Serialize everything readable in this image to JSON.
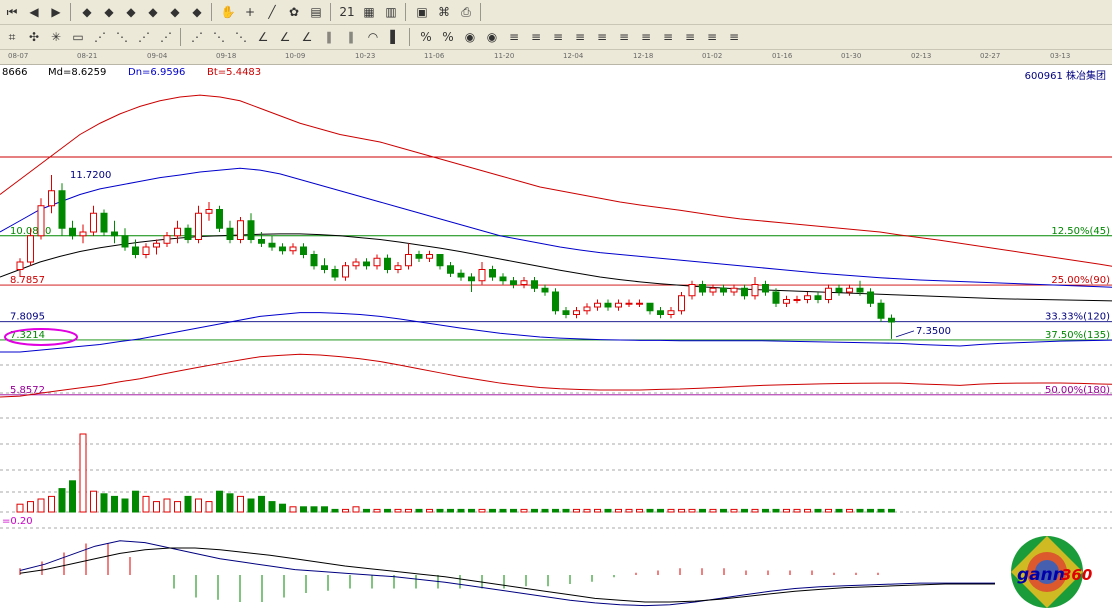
{
  "toolbar1": {
    "buttons": [
      {
        "icon": "first-icon",
        "glyph": "⏮"
      },
      {
        "icon": "back-icon",
        "glyph": "◀"
      },
      {
        "icon": "forward-icon",
        "glyph": "▶"
      },
      {
        "icon": "gann-diamond-1-icon",
        "glyph": "◆"
      },
      {
        "icon": "gann-diamond-2-icon",
        "glyph": "◆"
      },
      {
        "icon": "gann-diamond-3-icon",
        "glyph": "◆"
      },
      {
        "icon": "gann-diamond-4-icon",
        "glyph": "◆"
      },
      {
        "icon": "gann-diamond-5-icon",
        "glyph": "◆"
      },
      {
        "icon": "gann-diamond-6-icon",
        "glyph": "◆"
      },
      {
        "icon": "hand-icon",
        "glyph": "✋"
      },
      {
        "icon": "crosshair-icon",
        "glyph": "+"
      },
      {
        "icon": "line-tool-icon",
        "glyph": "╱"
      },
      {
        "icon": "pattern-icon",
        "glyph": "✿"
      },
      {
        "icon": "stats-icon",
        "glyph": "▤"
      },
      {
        "icon": "calendar-icon",
        "glyph": "21"
      },
      {
        "icon": "calculator-icon",
        "glyph": "▦"
      },
      {
        "icon": "table-icon",
        "glyph": "▥"
      },
      {
        "icon": "save-icon",
        "glyph": "▣"
      },
      {
        "icon": "network-icon",
        "glyph": "⌘"
      },
      {
        "icon": "print-icon",
        "glyph": "⎙"
      }
    ]
  },
  "toolbar2": {
    "buttons": [
      {
        "icon": "gann-grid-icon",
        "glyph": "⌗"
      },
      {
        "icon": "gann-square-icon",
        "glyph": "✣"
      },
      {
        "icon": "gann-wheel-icon",
        "glyph": "✳"
      },
      {
        "icon": "box-icon",
        "glyph": "▭"
      },
      {
        "icon": "gann-fan-1-icon",
        "glyph": "⋰"
      },
      {
        "icon": "gann-fan-2-icon",
        "glyph": "⋱"
      },
      {
        "icon": "gann-fan-3-icon",
        "glyph": "⋰"
      },
      {
        "icon": "gann-fan-4-icon",
        "glyph": "⋰"
      },
      {
        "icon": "gann-fan-5-icon",
        "glyph": "⋰"
      },
      {
        "icon": "gann-fan-6-icon",
        "glyph": "⋱"
      },
      {
        "icon": "gann-fan-7-icon",
        "glyph": "⋱"
      },
      {
        "icon": "angle-1-icon",
        "glyph": "∠"
      },
      {
        "icon": "angle-2-icon",
        "glyph": "∠"
      },
      {
        "icon": "angle-3-icon",
        "glyph": "∠"
      },
      {
        "icon": "time-cycle-icon",
        "glyph": "∥"
      },
      {
        "icon": "time-cycle-2-icon",
        "glyph": "∥"
      },
      {
        "icon": "arc-icon",
        "glyph": "◠"
      },
      {
        "icon": "column-icon",
        "glyph": "▌"
      },
      {
        "icon": "percent-1-icon",
        "glyph": "%"
      },
      {
        "icon": "percent-2-icon",
        "glyph": "%"
      },
      {
        "icon": "gold-1-icon",
        "glyph": "◉"
      },
      {
        "icon": "gold-2-icon",
        "glyph": "◉"
      },
      {
        "icon": "fib-1-icon",
        "glyph": "≡"
      },
      {
        "icon": "fib-2-icon",
        "glyph": "≡"
      },
      {
        "icon": "fib-3-icon",
        "glyph": "≡"
      },
      {
        "icon": "fib-4-icon",
        "glyph": "≡"
      },
      {
        "icon": "fib-5-icon",
        "glyph": "≡"
      },
      {
        "icon": "fib-6-icon",
        "glyph": "≡"
      },
      {
        "icon": "fib-7-icon",
        "glyph": "≡"
      },
      {
        "icon": "fib-8-icon",
        "glyph": "≡"
      },
      {
        "icon": "fib-9-icon",
        "glyph": "≡"
      },
      {
        "icon": "fib-10-icon",
        "glyph": "≡"
      },
      {
        "icon": "fib-11-icon",
        "glyph": "≡"
      }
    ]
  },
  "date_axis": {
    "ticks": [
      "08-07",
      "08-21",
      "09-04",
      "09-18",
      "10-09",
      "10-23",
      "11-06",
      "11-20",
      "12-04",
      "12-18",
      "01-02",
      "01-16",
      "01-30",
      "02-13",
      "02-27",
      "03-13"
    ]
  },
  "info_bar": {
    "partial_value": "8666",
    "md": "Md=8.6259",
    "dn": "Dn=6.9596",
    "bt": "Bt=5.4483",
    "stock": "600961  株冶集团"
  },
  "colors": {
    "up": "#e00000",
    "down": "#008800",
    "upper_band": "#cc0000",
    "ma_blue": "#0000cc",
    "ma_black": "#000000",
    "fib_purple": "#990099",
    "ellipse": "#e000e0",
    "grid_dash": "#555555"
  },
  "chart_data": {
    "type": "candlestick",
    "title": "",
    "xlabel": "",
    "ylabel": "",
    "x": [
      "08-07",
      "08-21",
      "09-04",
      "09-18",
      "10-09",
      "10-23",
      "11-06",
      "11-20",
      "12-04",
      "12-18",
      "01-02",
      "01-16",
      "01-30",
      "02-13",
      "02-27",
      "03-13"
    ],
    "price_annotations": {
      "high_label": "11.7200",
      "low_label": "7.3500"
    },
    "horizontal_levels": [
      {
        "value": 12.2,
        "color": "#cc0000",
        "left_label": "",
        "right_label": ""
      },
      {
        "value": 10.1,
        "color": "#008800",
        "left_label": "10.0800",
        "right_label": "12.50%(45)"
      },
      {
        "value": 8.7857,
        "color": "#cc0000",
        "left_label": "8.7857",
        "right_label": "25.00%(90)"
      },
      {
        "value": 7.8095,
        "color": "#000080",
        "left_label": "7.8095",
        "right_label": "33.33%(120)"
      },
      {
        "value": 7.3214,
        "color": "#008800",
        "left_label": "7.3214",
        "right_label": "37.50%(135)"
      },
      {
        "value": 5.8572,
        "color": "#990099",
        "left_label": "5.8572",
        "right_label": "50.00%(180)"
      }
    ],
    "candles": [
      {
        "o": 9.2,
        "h": 9.5,
        "l": 9.0,
        "c": 9.4
      },
      {
        "o": 9.4,
        "h": 10.3,
        "l": 9.3,
        "c": 10.1
      },
      {
        "o": 10.1,
        "h": 11.1,
        "l": 10.0,
        "c": 10.9
      },
      {
        "o": 10.9,
        "h": 11.72,
        "l": 10.7,
        "c": 11.3
      },
      {
        "o": 11.3,
        "h": 11.5,
        "l": 10.1,
        "c": 10.3
      },
      {
        "o": 10.3,
        "h": 10.5,
        "l": 10.0,
        "c": 10.1
      },
      {
        "o": 10.1,
        "h": 10.4,
        "l": 9.9,
        "c": 10.2
      },
      {
        "o": 10.2,
        "h": 10.9,
        "l": 10.1,
        "c": 10.7
      },
      {
        "o": 10.7,
        "h": 10.8,
        "l": 10.1,
        "c": 10.2
      },
      {
        "o": 10.2,
        "h": 10.5,
        "l": 9.9,
        "c": 10.1
      },
      {
        "o": 10.1,
        "h": 10.3,
        "l": 9.7,
        "c": 9.8
      },
      {
        "o": 9.8,
        "h": 10.0,
        "l": 9.5,
        "c": 9.6
      },
      {
        "o": 9.6,
        "h": 9.9,
        "l": 9.5,
        "c": 9.8
      },
      {
        "o": 9.8,
        "h": 10.0,
        "l": 9.6,
        "c": 9.9
      },
      {
        "o": 9.9,
        "h": 10.2,
        "l": 9.8,
        "c": 10.1
      },
      {
        "o": 10.1,
        "h": 10.5,
        "l": 9.9,
        "c": 10.3
      },
      {
        "o": 10.3,
        "h": 10.4,
        "l": 9.9,
        "c": 10.0
      },
      {
        "o": 10.0,
        "h": 10.9,
        "l": 9.9,
        "c": 10.7
      },
      {
        "o": 10.7,
        "h": 11.0,
        "l": 10.5,
        "c": 10.8
      },
      {
        "o": 10.8,
        "h": 10.9,
        "l": 10.2,
        "c": 10.3
      },
      {
        "o": 10.3,
        "h": 10.5,
        "l": 9.9,
        "c": 10.0
      },
      {
        "o": 10.0,
        "h": 10.6,
        "l": 9.9,
        "c": 10.5
      },
      {
        "o": 10.5,
        "h": 10.7,
        "l": 9.9,
        "c": 10.0
      },
      {
        "o": 10.0,
        "h": 10.2,
        "l": 9.8,
        "c": 9.9
      },
      {
        "o": 9.9,
        "h": 10.1,
        "l": 9.7,
        "c": 9.8
      },
      {
        "o": 9.8,
        "h": 9.9,
        "l": 9.6,
        "c": 9.7
      },
      {
        "o": 9.7,
        "h": 9.9,
        "l": 9.6,
        "c": 9.8
      },
      {
        "o": 9.8,
        "h": 9.9,
        "l": 9.5,
        "c": 9.6
      },
      {
        "o": 9.6,
        "h": 9.7,
        "l": 9.2,
        "c": 9.3
      },
      {
        "o": 9.3,
        "h": 9.5,
        "l": 9.1,
        "c": 9.2
      },
      {
        "o": 9.2,
        "h": 9.3,
        "l": 8.9,
        "c": 9.0
      },
      {
        "o": 9.0,
        "h": 9.4,
        "l": 8.9,
        "c": 9.3
      },
      {
        "o": 9.3,
        "h": 9.5,
        "l": 9.2,
        "c": 9.4
      },
      {
        "o": 9.4,
        "h": 9.5,
        "l": 9.2,
        "c": 9.3
      },
      {
        "o": 9.3,
        "h": 9.6,
        "l": 9.2,
        "c": 9.5
      },
      {
        "o": 9.5,
        "h": 9.6,
        "l": 9.1,
        "c": 9.2
      },
      {
        "o": 9.2,
        "h": 9.4,
        "l": 9.1,
        "c": 9.3
      },
      {
        "o": 9.3,
        "h": 9.9,
        "l": 9.2,
        "c": 9.6
      },
      {
        "o": 9.6,
        "h": 9.7,
        "l": 9.4,
        "c": 9.5
      },
      {
        "o": 9.5,
        "h": 9.7,
        "l": 9.4,
        "c": 9.6
      },
      {
        "o": 9.6,
        "h": 9.6,
        "l": 9.2,
        "c": 9.3
      },
      {
        "o": 9.3,
        "h": 9.4,
        "l": 9.0,
        "c": 9.1
      },
      {
        "o": 9.1,
        "h": 9.2,
        "l": 8.9,
        "c": 9.0
      },
      {
        "o": 9.0,
        "h": 9.1,
        "l": 8.6,
        "c": 8.9
      },
      {
        "o": 8.9,
        "h": 9.4,
        "l": 8.8,
        "c": 9.2
      },
      {
        "o": 9.2,
        "h": 9.3,
        "l": 8.9,
        "c": 9.0
      },
      {
        "o": 9.0,
        "h": 9.1,
        "l": 8.8,
        "c": 8.9
      },
      {
        "o": 8.9,
        "h": 9.0,
        "l": 8.7,
        "c": 8.8
      },
      {
        "o": 8.8,
        "h": 9.0,
        "l": 8.7,
        "c": 8.9
      },
      {
        "o": 8.9,
        "h": 9.0,
        "l": 8.6,
        "c": 8.7
      },
      {
        "o": 8.7,
        "h": 8.8,
        "l": 8.5,
        "c": 8.6
      },
      {
        "o": 8.6,
        "h": 8.7,
        "l": 8.0,
        "c": 8.1
      },
      {
        "o": 8.1,
        "h": 8.2,
        "l": 7.9,
        "c": 8.0
      },
      {
        "o": 8.0,
        "h": 8.2,
        "l": 7.9,
        "c": 8.1
      },
      {
        "o": 8.1,
        "h": 8.3,
        "l": 8.0,
        "c": 8.2
      },
      {
        "o": 8.2,
        "h": 8.4,
        "l": 8.1,
        "c": 8.3
      },
      {
        "o": 8.3,
        "h": 8.4,
        "l": 8.1,
        "c": 8.2
      },
      {
        "o": 8.2,
        "h": 8.4,
        "l": 8.1,
        "c": 8.3
      },
      {
        "o": 8.3,
        "h": 8.4,
        "l": 8.2,
        "c": 8.3
      },
      {
        "o": 8.3,
        "h": 8.4,
        "l": 8.2,
        "c": 8.3
      },
      {
        "o": 8.3,
        "h": 8.3,
        "l": 8.0,
        "c": 8.1
      },
      {
        "o": 8.1,
        "h": 8.2,
        "l": 7.9,
        "c": 8.0
      },
      {
        "o": 8.0,
        "h": 8.2,
        "l": 7.9,
        "c": 8.1
      },
      {
        "o": 8.1,
        "h": 8.6,
        "l": 8.0,
        "c": 8.5
      },
      {
        "o": 8.5,
        "h": 8.9,
        "l": 8.4,
        "c": 8.8
      },
      {
        "o": 8.8,
        "h": 8.9,
        "l": 8.5,
        "c": 8.6
      },
      {
        "o": 8.6,
        "h": 8.8,
        "l": 8.5,
        "c": 8.7
      },
      {
        "o": 8.7,
        "h": 8.8,
        "l": 8.5,
        "c": 8.6
      },
      {
        "o": 8.6,
        "h": 8.8,
        "l": 8.5,
        "c": 8.7
      },
      {
        "o": 8.7,
        "h": 8.8,
        "l": 8.4,
        "c": 8.5
      },
      {
        "o": 8.5,
        "h": 9.0,
        "l": 8.4,
        "c": 8.8
      },
      {
        "o": 8.8,
        "h": 8.9,
        "l": 8.5,
        "c": 8.6
      },
      {
        "o": 8.6,
        "h": 8.7,
        "l": 8.2,
        "c": 8.3
      },
      {
        "o": 8.3,
        "h": 8.5,
        "l": 8.2,
        "c": 8.4
      },
      {
        "o": 8.4,
        "h": 8.5,
        "l": 8.3,
        "c": 8.4
      },
      {
        "o": 8.4,
        "h": 8.6,
        "l": 8.3,
        "c": 8.5
      },
      {
        "o": 8.5,
        "h": 8.6,
        "l": 8.3,
        "c": 8.4
      },
      {
        "o": 8.4,
        "h": 8.8,
        "l": 8.3,
        "c": 8.7
      },
      {
        "o": 8.7,
        "h": 8.8,
        "l": 8.5,
        "c": 8.6
      },
      {
        "o": 8.6,
        "h": 8.8,
        "l": 8.5,
        "c": 8.7
      },
      {
        "o": 8.7,
        "h": 8.9,
        "l": 8.5,
        "c": 8.6
      },
      {
        "o": 8.6,
        "h": 8.7,
        "l": 8.2,
        "c": 8.3
      },
      {
        "o": 8.3,
        "h": 8.4,
        "l": 7.8,
        "c": 7.9
      },
      {
        "o": 7.9,
        "h": 8.0,
        "l": 7.35,
        "c": 7.8
      }
    ],
    "ma_blue": [
      10.2,
      10.5,
      10.8,
      11.0,
      11.2,
      11.35,
      11.45,
      11.55,
      11.65,
      11.72,
      11.8,
      11.85,
      11.9,
      11.85,
      11.75,
      11.6,
      11.45,
      11.3,
      11.15,
      11.0,
      10.85,
      10.7,
      10.55,
      10.4,
      10.25,
      10.1,
      10.0,
      9.9,
      9.8,
      9.72,
      9.65,
      9.6,
      9.55,
      9.5,
      9.45,
      9.4,
      9.35,
      9.3,
      9.25,
      9.2,
      9.15,
      9.1,
      9.06,
      9.02,
      8.98,
      8.95,
      8.92,
      8.9,
      8.88,
      8.86,
      8.84,
      8.82,
      8.8,
      8.78,
      8.76,
      8.74,
      8.72
    ],
    "ma_black": [
      9.0,
      9.2,
      9.4,
      9.55,
      9.68,
      9.78,
      9.86,
      9.93,
      9.99,
      10.04,
      10.08,
      10.1,
      10.12,
      10.14,
      10.15,
      10.15,
      10.13,
      10.1,
      10.05,
      10.0,
      9.93,
      9.85,
      9.77,
      9.68,
      9.58,
      9.48,
      9.38,
      9.28,
      9.18,
      9.09,
      9.0,
      8.93,
      8.87,
      8.82,
      8.78,
      8.74,
      8.71,
      8.68,
      8.66,
      8.64,
      8.62,
      8.6,
      8.58,
      8.56,
      8.54,
      8.52,
      8.5,
      8.48,
      8.46,
      8.44,
      8.42,
      8.41,
      8.4,
      8.39,
      8.38,
      8.37,
      8.36
    ],
    "upper_band": [
      11.2,
      11.6,
      12.0,
      12.4,
      12.8,
      13.1,
      13.35,
      13.55,
      13.7,
      13.8,
      13.85,
      13.8,
      13.7,
      13.5,
      13.3,
      13.1,
      12.95,
      12.8,
      12.7,
      12.6,
      12.45,
      12.3,
      12.15,
      12.0,
      11.85,
      11.7,
      11.55,
      11.4,
      11.3,
      11.2,
      11.1,
      11.0,
      10.92,
      10.85,
      10.78,
      10.7,
      10.62,
      10.55,
      10.5,
      10.45,
      10.4,
      10.35,
      10.3,
      10.25,
      10.2,
      10.12,
      10.05,
      9.98,
      9.9,
      9.82,
      9.74,
      9.66,
      9.58,
      9.5,
      9.42,
      9.34,
      9.25
    ],
    "lower_band": [
      7.0,
      7.0,
      7.05,
      7.1,
      7.15,
      7.2,
      7.28,
      7.35,
      7.45,
      7.55,
      7.65,
      7.75,
      7.85,
      7.95,
      8.0,
      8.05,
      8.05,
      8.03,
      8.0,
      7.95,
      7.88,
      7.8,
      7.72,
      7.64,
      7.57,
      7.5,
      7.45,
      7.4,
      7.37,
      7.35,
      7.33,
      7.32,
      7.31,
      7.31,
      7.3,
      7.3,
      7.3,
      7.3,
      7.3,
      7.29,
      7.28,
      7.27,
      7.26,
      7.25,
      7.24,
      7.23,
      7.2,
      7.18,
      7.16,
      7.2,
      7.23,
      7.25,
      7.27,
      7.29,
      7.3,
      7.31,
      7.32
    ],
    "volume_label": "",
    "volume": [
      3,
      4,
      5,
      6,
      9,
      12,
      30,
      8,
      7,
      6,
      5,
      8,
      6,
      4,
      5,
      4,
      6,
      5,
      4,
      8,
      7,
      6,
      5,
      6,
      4,
      3,
      2,
      2,
      2,
      2,
      1,
      1,
      2,
      1,
      1,
      1,
      1,
      1,
      1,
      1,
      1,
      1,
      1,
      1,
      1,
      1,
      1,
      1,
      1,
      1,
      1,
      1,
      1,
      1,
      1,
      1,
      1,
      1,
      1,
      1,
      1,
      1,
      1,
      1,
      1,
      1,
      1,
      1,
      1,
      1,
      1,
      1,
      1,
      1,
      1,
      1,
      1,
      1,
      1,
      1,
      1,
      1,
      1,
      1
    ],
    "macd_label": "=0.20",
    "macd_dif": [
      0.05,
      0.12,
      0.22,
      0.32,
      0.38,
      0.36,
      0.3,
      0.24,
      0.18,
      0.14,
      0.1,
      0.06,
      0.04,
      0.02,
      0.0,
      -0.02,
      -0.05,
      -0.08,
      -0.12,
      -0.16,
      -0.2,
      -0.24,
      -0.28,
      -0.31,
      -0.33,
      -0.34,
      -0.33,
      -0.3,
      -0.26,
      -0.22,
      -0.18,
      -0.15,
      -0.13,
      -0.12,
      -0.11,
      -0.1,
      -0.09,
      -0.09,
      -0.09,
      -0.09
    ],
    "macd_dea": [
      0.02,
      0.06,
      0.12,
      0.18,
      0.24,
      0.28,
      0.3,
      0.3,
      0.28,
      0.25,
      0.22,
      0.18,
      0.14,
      0.1,
      0.07,
      0.04,
      0.01,
      -0.02,
      -0.06,
      -0.1,
      -0.14,
      -0.18,
      -0.22,
      -0.26,
      -0.28,
      -0.3,
      -0.3,
      -0.29,
      -0.27,
      -0.24,
      -0.21,
      -0.18,
      -0.16,
      -0.14,
      -0.13,
      -0.12,
      -0.11,
      -0.1,
      -0.1,
      -0.1
    ]
  }
}
